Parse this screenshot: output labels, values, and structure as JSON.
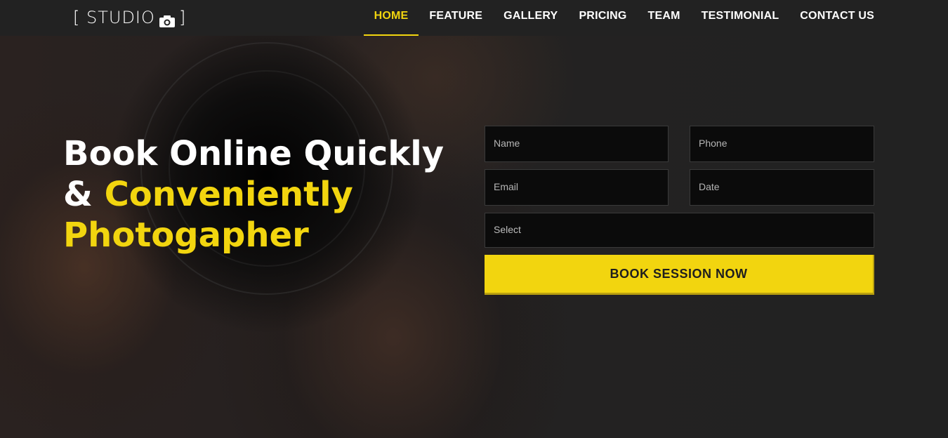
{
  "brand": {
    "logo_text_open": "[ STUDIO",
    "logo_text_close": "]",
    "logo_icon": "camera-icon"
  },
  "nav": {
    "items": [
      {
        "label": "HOME",
        "active": true
      },
      {
        "label": "FEATURE",
        "active": false
      },
      {
        "label": "GALLERY",
        "active": false
      },
      {
        "label": "PRICING",
        "active": false
      },
      {
        "label": "TEAM",
        "active": false
      },
      {
        "label": "TESTIMONIAL",
        "active": false
      },
      {
        "label": "CONTACT US",
        "active": false
      }
    ]
  },
  "hero": {
    "line1": "Book Online Quickly",
    "line2_white": "& ",
    "line2_yellow": "Conveniently",
    "line3": "Photogapher"
  },
  "form": {
    "name_placeholder": "Name",
    "phone_placeholder": "Phone",
    "email_placeholder": "Email",
    "date_placeholder": "Date",
    "select_value": "Select",
    "submit_label": "BOOK SESSION NOW"
  },
  "colors": {
    "accent": "#f2d50f",
    "header_bg": "#222222",
    "field_bg": "#0b0b0b"
  }
}
